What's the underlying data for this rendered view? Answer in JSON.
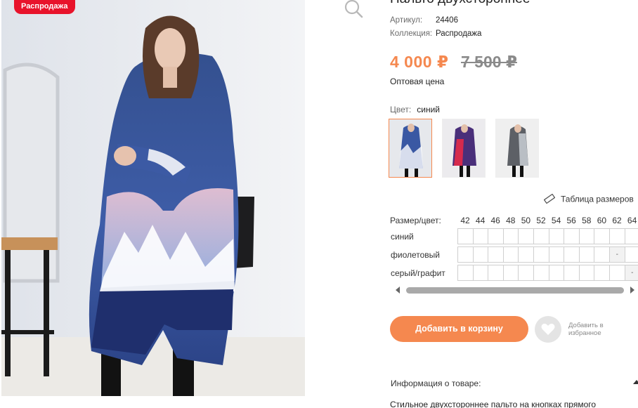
{
  "badge": {
    "sale": "Распродажа"
  },
  "product": {
    "title": "Пальто двухстороннее",
    "article_label": "Артикул:",
    "article_value": "24406",
    "collection_label": "Коллекция:",
    "collection_value": "Распродажа",
    "price": "4 000 ₽",
    "old_price": "7 500 ₽",
    "wholesale_label": "Оптовая цена"
  },
  "colors": {
    "label": "Цвет:",
    "selected": "синий",
    "swatches": [
      "синий",
      "фиолетовый",
      "серый/графит"
    ]
  },
  "size_table_link": "Таблица размеров",
  "sizes": {
    "header": "Размер/цвет:",
    "list": [
      "42",
      "44",
      "46",
      "48",
      "50",
      "52",
      "54",
      "56",
      "58",
      "60",
      "62",
      "64"
    ],
    "rows": [
      {
        "label": "синий",
        "cells": [
          "",
          "",
          "",
          "",
          "",
          "",
          "",
          "",
          "",
          "",
          "",
          ""
        ]
      },
      {
        "label": "фиолетовый",
        "cells": [
          "",
          "",
          "",
          "",
          "",
          "",
          "",
          "",
          "",
          "",
          "-",
          ""
        ]
      },
      {
        "label": "серый/графит",
        "cells": [
          "",
          "",
          "",
          "",
          "",
          "",
          "",
          "",
          "",
          "",
          "",
          "-"
        ]
      }
    ]
  },
  "actions": {
    "add_to_cart": "Добавить в корзину",
    "favorite_line1": "Добавить в",
    "favorite_line2": "избранное"
  },
  "info": {
    "title": "Информация о товаре:",
    "description": "Стильное двухстороннее пальто на кнопках прямого"
  },
  "theme": {
    "accent": "#f5884f",
    "sale_red": "#e8132b",
    "coat_blue": "#2f4a8f"
  }
}
